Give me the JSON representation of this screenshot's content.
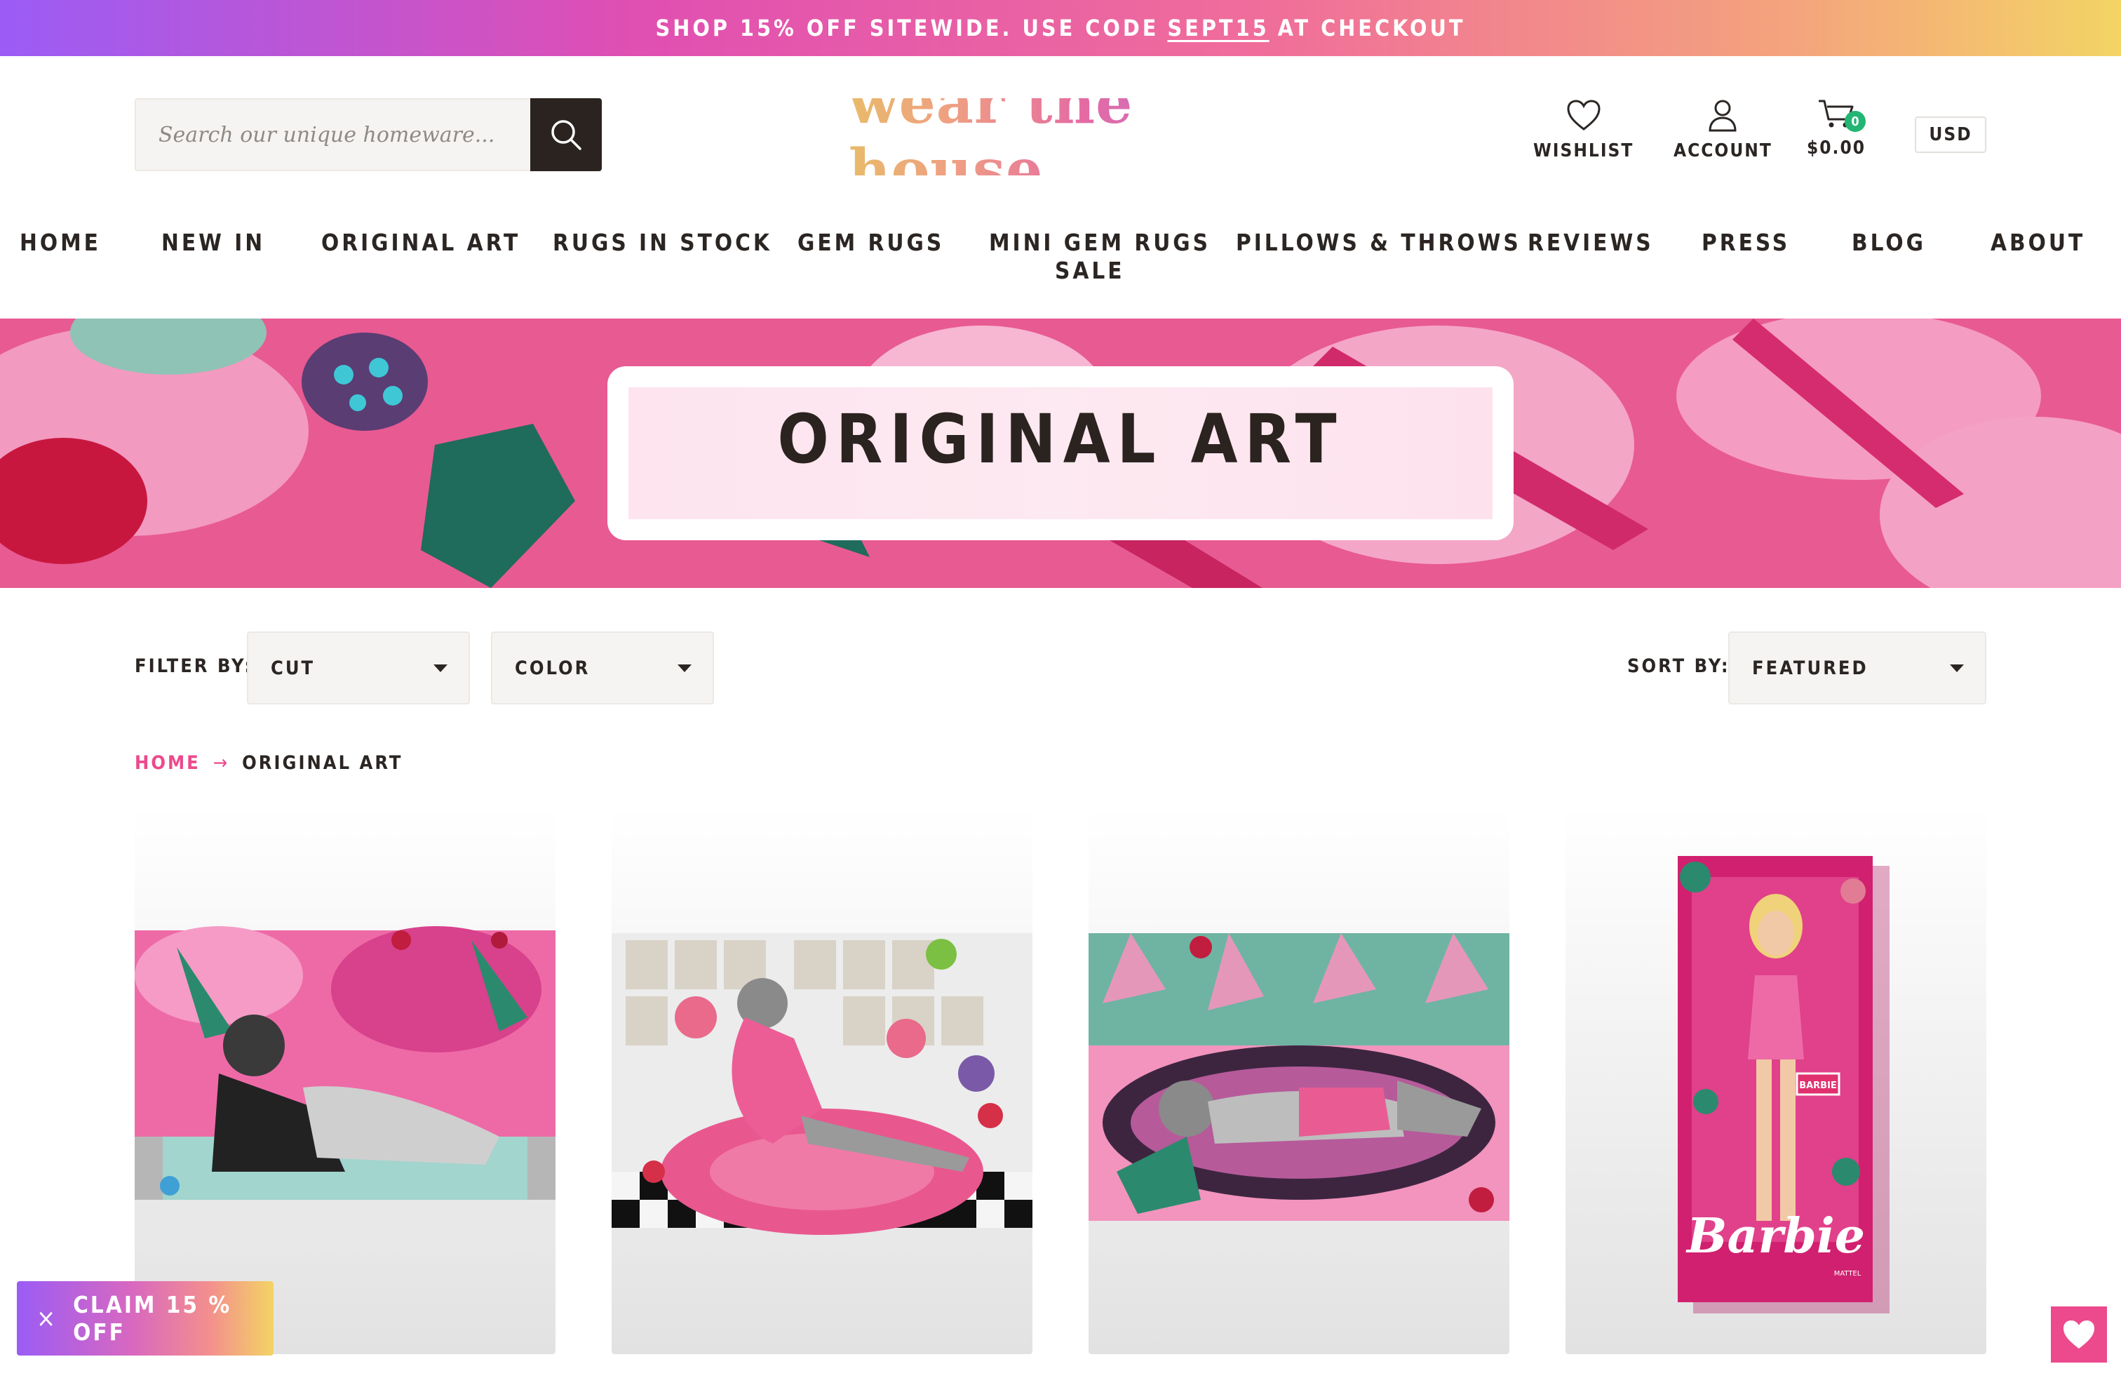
{
  "promo": {
    "prefix": "SHOP 15% OFF SITEWIDE. USE CODE",
    "code": "SEPT15",
    "suffix": "AT CHECKOUT"
  },
  "search": {
    "placeholder": "Search our unique homeware..."
  },
  "logo": {
    "text": "wear the house"
  },
  "header": {
    "wishlist_label": "WISHLIST",
    "account_label": "ACCOUNT",
    "cart_total": "$0.00",
    "cart_count": "0",
    "currency": "USD"
  },
  "nav": [
    "HOME",
    "NEW IN",
    "ORIGINAL ART",
    "RUGS IN STOCK",
    "GEM RUGS",
    "MINI GEM RUGS",
    "SALE",
    "PILLOWS & THROWS",
    "REVIEWS",
    "PRESS",
    "BLOG",
    "ABOUT"
  ],
  "hero": {
    "title": "ORIGINAL ART"
  },
  "filters": {
    "filter_label": "FILTER BY:",
    "cut": "CUT",
    "color": "COLOR",
    "sort_label": "SORT BY:",
    "sort_value": "FEATURED"
  },
  "breadcrumb": {
    "home": "HOME",
    "arrow": "→",
    "current": "ORIGINAL ART"
  },
  "products": {
    "barbie_logo": "Barbie",
    "barbie_box_brand": "MATTEL",
    "label_tag": "BARBIE"
  },
  "claim": {
    "close": "×",
    "label": "CLAIM 15 % OFF"
  },
  "colors": {
    "accent_pink": "#ec4a8c",
    "dark": "#2b231f",
    "badge_green": "#22b573"
  }
}
